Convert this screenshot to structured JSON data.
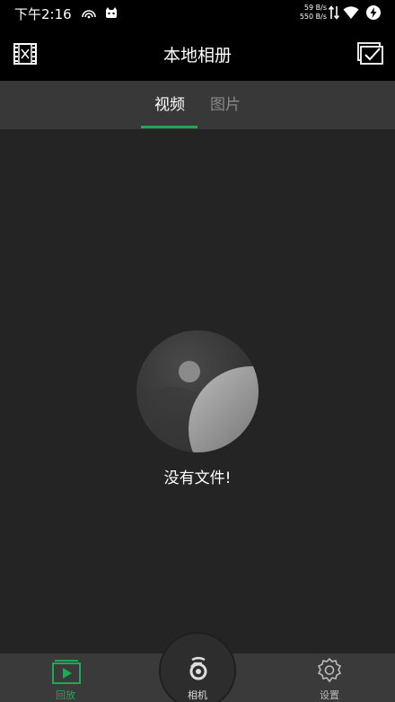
{
  "status_bar": {
    "time": "下午2:16",
    "speed_up": "59 B/s",
    "speed_down": "550 B/s"
  },
  "app_bar": {
    "title": "本地相册"
  },
  "tabs": [
    {
      "label": "视频",
      "active": true
    },
    {
      "label": "图片",
      "active": false
    }
  ],
  "empty_state": {
    "message": "没有文件!"
  },
  "bottom_nav": {
    "items": [
      {
        "label": "回放",
        "active": true
      },
      {
        "label": "相机",
        "active": false
      },
      {
        "label": "设置",
        "active": false
      }
    ]
  },
  "colors": {
    "accent": "#1fa855",
    "header": "#000000",
    "tab_bar": "#383838",
    "content_bg": "#242424",
    "bottom_nav": "#3a3a3a"
  }
}
